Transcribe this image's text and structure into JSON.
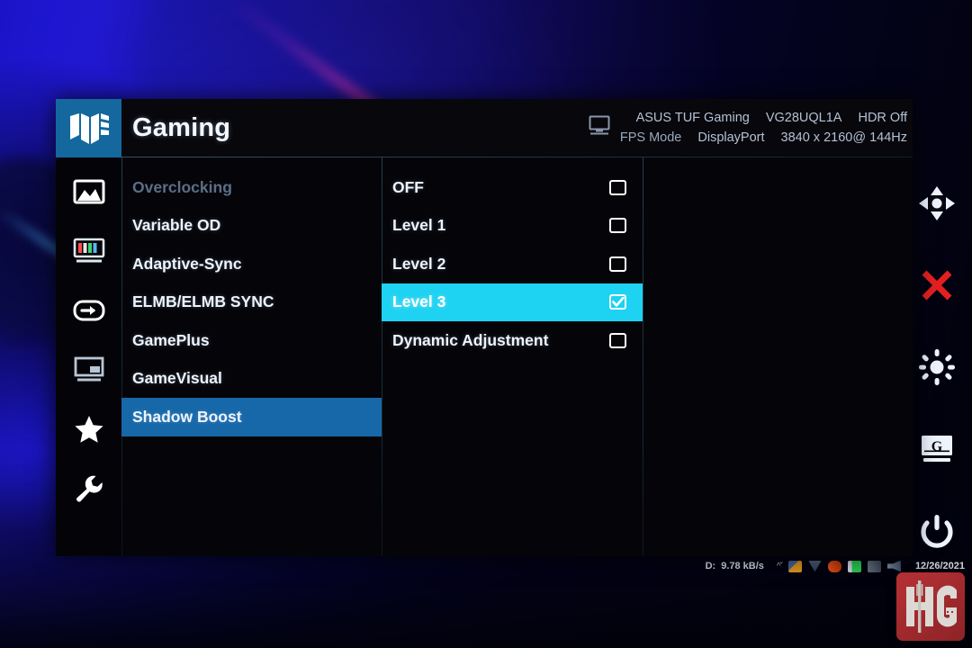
{
  "wallpaper": {
    "description": "blue gradient desktop wallpaper with magenta diagonal light streak"
  },
  "osd": {
    "brand_icon": "tuf-gaming-logo-icon",
    "title": "Gaming",
    "monitor_icon": "monitor-icon",
    "info": {
      "line1": {
        "brand": "ASUS TUF Gaming",
        "model": "VG28UQL1A",
        "hdr": "HDR Off"
      },
      "line2": {
        "mode": "FPS Mode",
        "input": "DisplayPort",
        "resolution": "3840 x 2160@ 144Hz"
      }
    },
    "rail": [
      {
        "name": "image-icon",
        "label": "Image"
      },
      {
        "name": "color-icon",
        "label": "Color"
      },
      {
        "name": "input-select-icon",
        "label": "Input Select"
      },
      {
        "name": "pip-pbp-icon",
        "label": "PIP/PBP"
      },
      {
        "name": "myfavorite-star-icon",
        "label": "MyFavorite"
      },
      {
        "name": "system-setup-wrench-icon",
        "label": "System Setup"
      }
    ],
    "menu": [
      {
        "label": "Overclocking",
        "state": "disabled"
      },
      {
        "label": "Variable OD",
        "state": "normal"
      },
      {
        "label": "Adaptive-Sync",
        "state": "normal"
      },
      {
        "label": "ELMB/ELMB SYNC",
        "state": "normal"
      },
      {
        "label": "GamePlus",
        "state": "normal"
      },
      {
        "label": "GameVisual",
        "state": "normal"
      },
      {
        "label": "Shadow Boost",
        "state": "selected"
      }
    ],
    "submenu": [
      {
        "label": "OFF",
        "checked": false,
        "highlighted": false
      },
      {
        "label": "Level 1",
        "checked": false,
        "highlighted": false
      },
      {
        "label": "Level 2",
        "checked": false,
        "highlighted": false
      },
      {
        "label": "Level 3",
        "checked": true,
        "highlighted": true
      },
      {
        "label": "Dynamic Adjustment",
        "checked": false,
        "highlighted": false
      }
    ],
    "colors": {
      "panel_bg": "#050509",
      "brand_tile": "#14689e",
      "menu_highlight": "#1668a8",
      "submenu_highlight": "#1ed2f2",
      "text": "#eef4fb",
      "text_disabled": "#5c6f86"
    }
  },
  "controls": [
    {
      "name": "navigation-joystick-icon",
      "label": "Navigation"
    },
    {
      "name": "close-icon",
      "label": "Close",
      "color": "#e32020"
    },
    {
      "name": "brightness-icon",
      "label": "Brightness"
    },
    {
      "name": "gamevisual-g-icon",
      "label": "GameVisual",
      "letter": "G"
    },
    {
      "name": "power-icon",
      "label": "Power"
    }
  ],
  "taskbar": {
    "drive_label": "D:",
    "network_speed": "9.78 kB/s",
    "date": "12/26/2021",
    "tray_icons": [
      "chevron-up-icon",
      "folder-icon",
      "download-icon",
      "flame-icon",
      "battery-icon",
      "signal-icon",
      "volume-icon"
    ]
  },
  "watermark": {
    "text": "HG",
    "color": "#b93236"
  }
}
